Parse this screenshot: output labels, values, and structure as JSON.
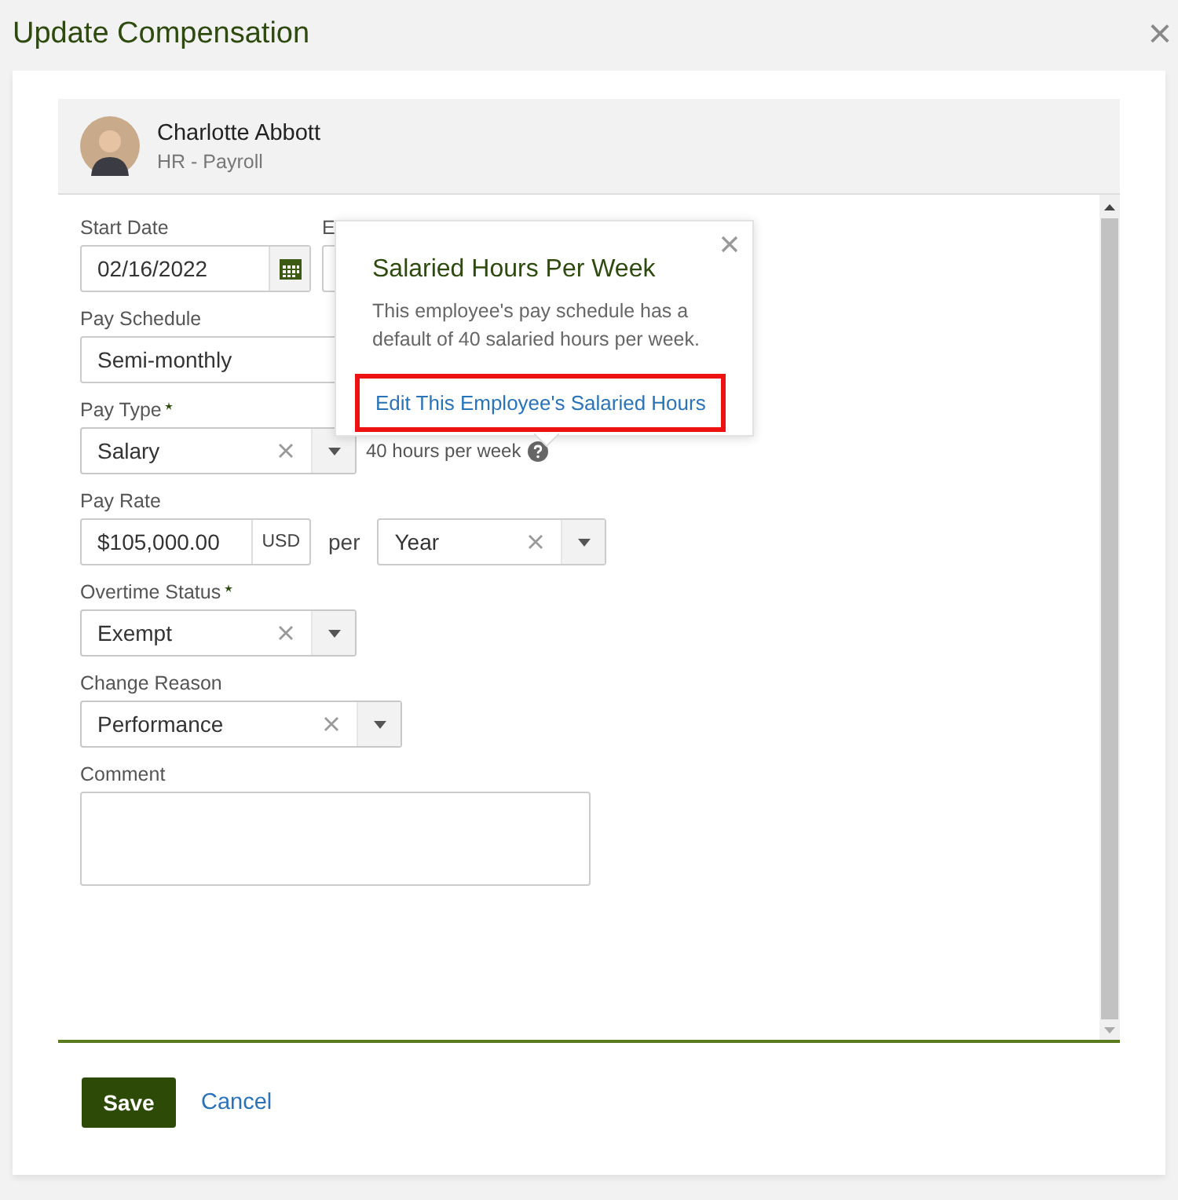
{
  "dialog": {
    "title": "Update Compensation",
    "close": "×"
  },
  "employee": {
    "name": "Charlotte Abbott",
    "department": "HR - Payroll"
  },
  "rows": [
    {
      "fields": [
        {
          "kind": "date",
          "label": "Start Date",
          "required": false,
          "value": "02/16/2022"
        },
        {
          "kind": "date",
          "label": "E"
        }
      ]
    },
    {
      "fields": [
        {
          "kind": "select",
          "label": "Pay Schedule",
          "required": false,
          "value": "Semi-monthly"
        }
      ]
    },
    {
      "fields": [
        {
          "kind": "select",
          "label": "Pay Type",
          "required": true,
          "value": "Salary",
          "clearable": true
        }
      ],
      "note": "40 hours per week"
    },
    {
      "fields": [
        {
          "kind": "money",
          "label": "Pay Rate",
          "required": false,
          "value": "$105,000.00",
          "currency": "USD",
          "connector": "per",
          "period": "Year"
        }
      ]
    },
    {
      "fields": [
        {
          "kind": "select",
          "label": "Overtime Status",
          "required": true,
          "value": "Exempt",
          "clearable": true
        }
      ]
    },
    {
      "fields": [
        {
          "kind": "select",
          "label": "Change Reason",
          "required": false,
          "value": "Performance",
          "clearable": true
        }
      ]
    },
    {
      "fields": [
        {
          "kind": "textarea",
          "label": "Comment",
          "required": false
        }
      ]
    }
  ],
  "popover": {
    "title": "Salaried Hours Per Week",
    "text": "This employee's pay schedule has a default of 40 salaried hours per week.",
    "link": "Edit This Employee's Salaried Hours",
    "highlighted": true
  },
  "buttons": {
    "save": "Save",
    "cancel": "Cancel"
  }
}
